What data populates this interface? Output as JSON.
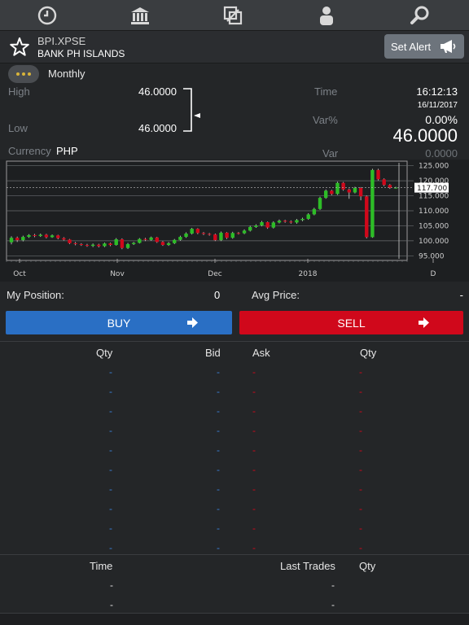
{
  "nav": {
    "icons": [
      "clock-icon",
      "bank-icon",
      "swap-icon",
      "person-icon",
      "search-icon"
    ]
  },
  "instrument": {
    "symbol": "BPI.XPSE",
    "name": "BANK PH ISLANDS",
    "alert_label": "Set Alert"
  },
  "quote": {
    "period": "Monthly",
    "high_label": "High",
    "high_value": "46.0000",
    "low_label": "Low",
    "low_value": "46.0000",
    "time_label": "Time",
    "time_value": "16:12:13",
    "date_value": "16/11/2017",
    "var_pct_label": "Var%",
    "var_pct_value": "0.00%",
    "last_price": "46.0000",
    "currency_label": "Currency",
    "currency_value": "PHP",
    "var_label": "Var",
    "var_value": "0.0000"
  },
  "chart_data": {
    "type": "candlestick",
    "x_tick_labels": [
      "Oct",
      "Nov",
      "Dec",
      "2018",
      "D"
    ],
    "y_tick_labels": [
      "125.000",
      "120.000",
      "115.000",
      "110.000",
      "105.000",
      "100.000",
      "95.000"
    ],
    "ylim": [
      94,
      126
    ],
    "current_value_label": "117.700",
    "current_value": 117.7,
    "grid": true,
    "up_color": "#2dbd27",
    "down_color": "#d0081b",
    "candles": [
      [
        99.5,
        101,
        98.8,
        101.5
      ],
      [
        101,
        100.2,
        99.6,
        101.4
      ],
      [
        100.2,
        101.3,
        99.8,
        101.7
      ],
      [
        101.3,
        101.9,
        101,
        102.2
      ],
      [
        101.9,
        101.6,
        101.2,
        102.3
      ],
      [
        101.6,
        102,
        101.3,
        102.4
      ],
      [
        102,
        101.2,
        100.8,
        102.3
      ],
      [
        101.2,
        101.8,
        101,
        102.1
      ],
      [
        101.8,
        100.9,
        100.5,
        102
      ],
      [
        100.9,
        100.4,
        100.1,
        101.2
      ],
      [
        100.4,
        99.2,
        98.9,
        100.6
      ],
      [
        99.2,
        98.9,
        98.5,
        99.6
      ],
      [
        98.9,
        98.6,
        98.3,
        99.2
      ],
      [
        98.6,
        98.3,
        98,
        99
      ],
      [
        98.3,
        98.7,
        97.9,
        99.1
      ],
      [
        98.7,
        98.2,
        97.8,
        99
      ],
      [
        98.2,
        99.1,
        97.9,
        99.4
      ],
      [
        99.1,
        98.6,
        98.2,
        99.4
      ],
      [
        98.6,
        100.5,
        98.4,
        100.9
      ],
      [
        100.5,
        97.6,
        97.2,
        100.8
      ],
      [
        97.6,
        98.9,
        97.3,
        99.3
      ],
      [
        98.9,
        99.3,
        98.6,
        99.6
      ],
      [
        99.3,
        100.6,
        99.1,
        100.9
      ],
      [
        100.6,
        100.3,
        99.9,
        101
      ],
      [
        100.3,
        101.1,
        100,
        101.4
      ],
      [
        101.1,
        99.6,
        99.3,
        101.3
      ],
      [
        99.6,
        98.6,
        98.3,
        99.9
      ],
      [
        98.6,
        99.2,
        98.3,
        99.6
      ],
      [
        99.2,
        100.3,
        98.9,
        100.6
      ],
      [
        100.3,
        101.3,
        100,
        101.7
      ],
      [
        101.3,
        102.4,
        101,
        102.8
      ],
      [
        102.4,
        104,
        102.1,
        104.3
      ],
      [
        104,
        102.6,
        102.2,
        104.2
      ],
      [
        102.6,
        102.3,
        101.9,
        102.9
      ],
      [
        102.3,
        102.1,
        101.7,
        102.6
      ],
      [
        102.1,
        100.2,
        99.9,
        102.4
      ],
      [
        100.2,
        102.7,
        99.9,
        103.1
      ],
      [
        102.7,
        101,
        100.6,
        102.9
      ],
      [
        101,
        102.6,
        100.7,
        103
      ],
      [
        102.6,
        102.5,
        102.1,
        102.9
      ],
      [
        102.5,
        103.4,
        102.2,
        103.8
      ],
      [
        103.4,
        104.6,
        103.1,
        105
      ],
      [
        104.6,
        105.1,
        104.3,
        105.5
      ],
      [
        105.1,
        106.2,
        104.8,
        106.6
      ],
      [
        106.2,
        104.4,
        104,
        106.4
      ],
      [
        104.4,
        106.1,
        104.1,
        106.5
      ],
      [
        106.1,
        106.7,
        105.8,
        107.1
      ],
      [
        106.7,
        106.4,
        106,
        107
      ],
      [
        106.4,
        106.1,
        105.7,
        106.8
      ],
      [
        106.1,
        106.9,
        105.7,
        107.3
      ],
      [
        106.9,
        107.3,
        106.5,
        107.7
      ],
      [
        107.3,
        108.8,
        107,
        109.2
      ],
      [
        108.8,
        110.6,
        108.5,
        111
      ],
      [
        110.6,
        114.3,
        110.3,
        114.7
      ],
      [
        114.3,
        116.7,
        114,
        117.1
      ],
      [
        116.7,
        115.6,
        115.2,
        117
      ],
      [
        115.6,
        119.3,
        115.3,
        119.7
      ],
      [
        119.3,
        117.1,
        116.7,
        119.6
      ],
      [
        117.1,
        116.1,
        114,
        117.4
      ],
      [
        116.1,
        117.6,
        115.8,
        118
      ],
      [
        117.6,
        114.8,
        113.5,
        117.9
      ],
      [
        114.8,
        101.2,
        100.8,
        115.1
      ],
      [
        101.2,
        123.6,
        101,
        124
      ],
      [
        123.6,
        120.5,
        120.1,
        124
      ],
      [
        120.5,
        118.6,
        118.2,
        120.8
      ],
      [
        118.6,
        117.7,
        117.3,
        118.9
      ],
      [
        117.7,
        117.7,
        117.4,
        118
      ]
    ]
  },
  "position": {
    "my_position_label": "My Position:",
    "my_position_value": "0",
    "avg_price_label": "Avg Price:",
    "avg_price_value": "-"
  },
  "actions": {
    "buy_label": "BUY",
    "sell_label": "SELL"
  },
  "book": {
    "headers": [
      "Qty",
      "Bid",
      "Ask",
      "Qty"
    ],
    "rows": [
      [
        "-",
        "-",
        "-",
        "-"
      ],
      [
        "-",
        "-",
        "-",
        "-"
      ],
      [
        "-",
        "-",
        "-",
        "-"
      ],
      [
        "-",
        "-",
        "-",
        "-"
      ],
      [
        "-",
        "-",
        "-",
        "-"
      ],
      [
        "-",
        "-",
        "-",
        "-"
      ],
      [
        "-",
        "-",
        "-",
        "-"
      ],
      [
        "-",
        "-",
        "-",
        "-"
      ],
      [
        "-",
        "-",
        "-",
        "-"
      ],
      [
        "-",
        "-",
        "-",
        "-"
      ]
    ]
  },
  "trades": {
    "headers": [
      "Time",
      "Last Trades",
      "Qty"
    ],
    "rows": [
      [
        "-",
        "-"
      ],
      [
        "-",
        "-"
      ]
    ]
  }
}
